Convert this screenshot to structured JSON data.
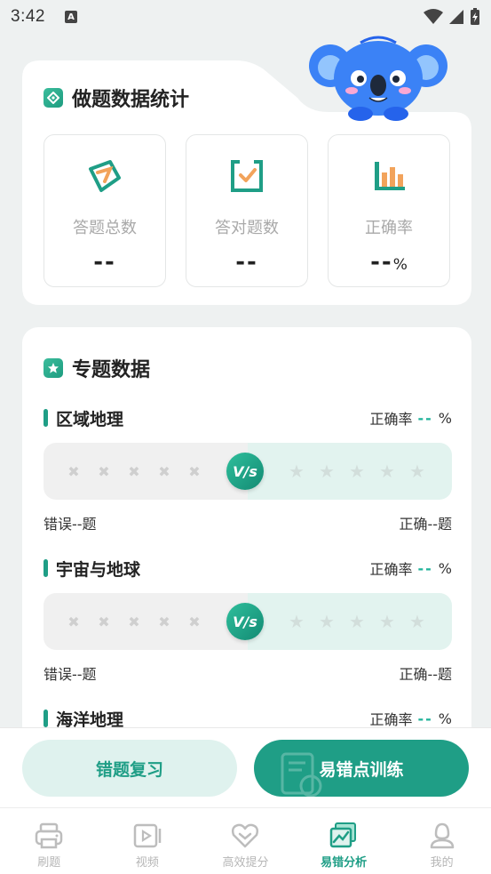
{
  "status_bar": {
    "time": "3:42",
    "notification": "A"
  },
  "stats_card": {
    "title": "做题数据统计",
    "items": [
      {
        "label": "答题总数",
        "value": "--",
        "suffix": ""
      },
      {
        "label": "答对题数",
        "value": "--",
        "suffix": ""
      },
      {
        "label": "正确率",
        "value": "--",
        "suffix": "%"
      }
    ]
  },
  "topics_card": {
    "title": "专题数据",
    "rate_label": "正确率",
    "rate_value": "--",
    "rate_suffix": "%",
    "wrong_label": "错误--题",
    "right_label": "正确--题",
    "vs_label": "V/s",
    "topics": [
      {
        "name": "区域地理"
      },
      {
        "name": "宇宙与地球"
      },
      {
        "name": "海洋地理"
      }
    ]
  },
  "actions": {
    "review": "错题复习",
    "train": "易错点训练"
  },
  "tabs": [
    {
      "label": "刷题",
      "icon": "printer-icon"
    },
    {
      "label": "视频",
      "icon": "video-icon"
    },
    {
      "label": "高效提分",
      "icon": "heart-chevron-icon"
    },
    {
      "label": "易错分析",
      "icon": "chart-image-icon",
      "active": true
    },
    {
      "label": "我的",
      "icon": "person-icon"
    }
  ],
  "colors": {
    "accent": "#1f9e86",
    "accent_light": "#dff2ee",
    "koala": "#3b82f6"
  }
}
